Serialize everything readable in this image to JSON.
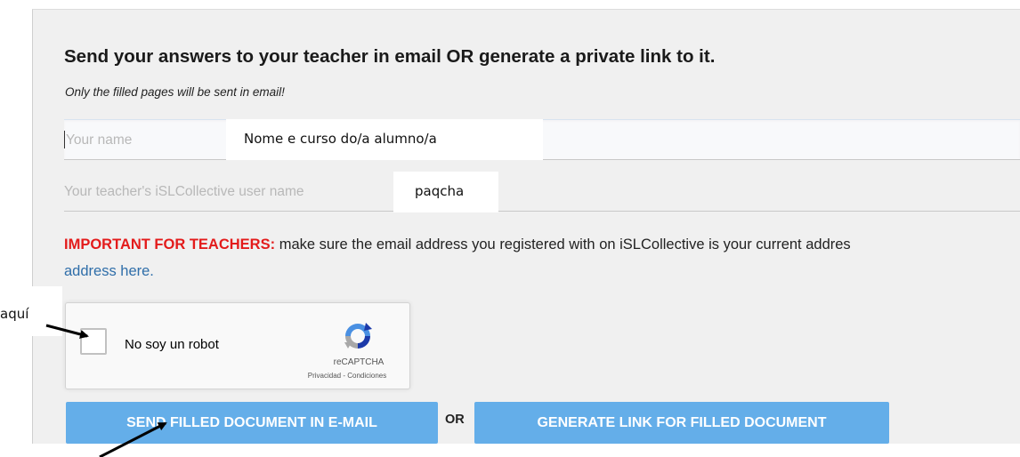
{
  "form": {
    "title": "Send your answers to your teacher in email OR generate a private link to it.",
    "subtitle": "Only the filled pages will be sent in email!",
    "name_field": {
      "placeholder": "Your name",
      "overlay_value": "Nome e curso do/a alumno/a"
    },
    "teacher_field": {
      "placeholder": "Your teacher's iSLCollective user name",
      "overlay_value": "paqcha"
    },
    "notice": {
      "important": "IMPORTANT FOR TEACHERS:",
      "text": " make sure the email address you registered with on iSLCollective is your current addres",
      "link": "address here."
    },
    "recaptcha": {
      "label": "No soy un robot",
      "brand": "reCAPTCHA",
      "links": "Privacidad - Condiciones",
      "logo_icon": "recaptcha-logo-icon"
    },
    "buttons": {
      "send_email": "SEND FILLED DOCUMENT IN E-MAIL",
      "or_label": "OR",
      "generate_link": "GENERATE LINK FOR FILLED DOCUMENT"
    }
  },
  "annotations": {
    "left_label": "aquí"
  },
  "colors": {
    "accent_button": "#64aee9",
    "important_red": "#e31b1b",
    "link_blue": "#2f6ea9",
    "panel_bg": "#f0f0f0"
  }
}
